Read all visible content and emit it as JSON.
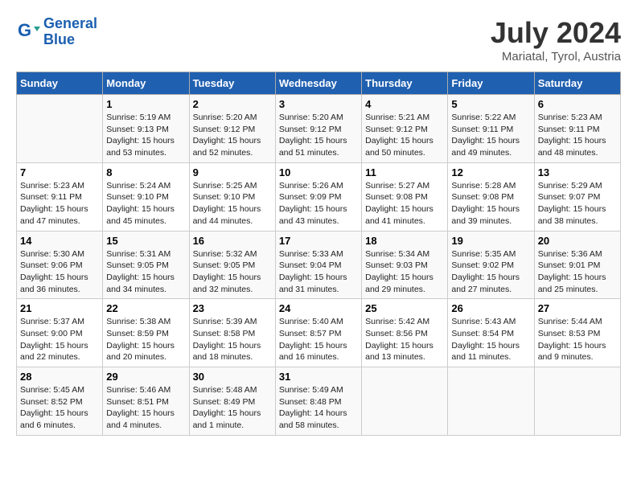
{
  "header": {
    "logo_line1": "General",
    "logo_line2": "Blue",
    "title": "July 2024",
    "location": "Mariatal, Tyrol, Austria"
  },
  "columns": [
    "Sunday",
    "Monday",
    "Tuesday",
    "Wednesday",
    "Thursday",
    "Friday",
    "Saturday"
  ],
  "weeks": [
    [
      {
        "day": "",
        "info": ""
      },
      {
        "day": "1",
        "info": "Sunrise: 5:19 AM\nSunset: 9:13 PM\nDaylight: 15 hours\nand 53 minutes."
      },
      {
        "day": "2",
        "info": "Sunrise: 5:20 AM\nSunset: 9:12 PM\nDaylight: 15 hours\nand 52 minutes."
      },
      {
        "day": "3",
        "info": "Sunrise: 5:20 AM\nSunset: 9:12 PM\nDaylight: 15 hours\nand 51 minutes."
      },
      {
        "day": "4",
        "info": "Sunrise: 5:21 AM\nSunset: 9:12 PM\nDaylight: 15 hours\nand 50 minutes."
      },
      {
        "day": "5",
        "info": "Sunrise: 5:22 AM\nSunset: 9:11 PM\nDaylight: 15 hours\nand 49 minutes."
      },
      {
        "day": "6",
        "info": "Sunrise: 5:23 AM\nSunset: 9:11 PM\nDaylight: 15 hours\nand 48 minutes."
      }
    ],
    [
      {
        "day": "7",
        "info": "Sunrise: 5:23 AM\nSunset: 9:11 PM\nDaylight: 15 hours\nand 47 minutes."
      },
      {
        "day": "8",
        "info": "Sunrise: 5:24 AM\nSunset: 9:10 PM\nDaylight: 15 hours\nand 45 minutes."
      },
      {
        "day": "9",
        "info": "Sunrise: 5:25 AM\nSunset: 9:10 PM\nDaylight: 15 hours\nand 44 minutes."
      },
      {
        "day": "10",
        "info": "Sunrise: 5:26 AM\nSunset: 9:09 PM\nDaylight: 15 hours\nand 43 minutes."
      },
      {
        "day": "11",
        "info": "Sunrise: 5:27 AM\nSunset: 9:08 PM\nDaylight: 15 hours\nand 41 minutes."
      },
      {
        "day": "12",
        "info": "Sunrise: 5:28 AM\nSunset: 9:08 PM\nDaylight: 15 hours\nand 39 minutes."
      },
      {
        "day": "13",
        "info": "Sunrise: 5:29 AM\nSunset: 9:07 PM\nDaylight: 15 hours\nand 38 minutes."
      }
    ],
    [
      {
        "day": "14",
        "info": "Sunrise: 5:30 AM\nSunset: 9:06 PM\nDaylight: 15 hours\nand 36 minutes."
      },
      {
        "day": "15",
        "info": "Sunrise: 5:31 AM\nSunset: 9:05 PM\nDaylight: 15 hours\nand 34 minutes."
      },
      {
        "day": "16",
        "info": "Sunrise: 5:32 AM\nSunset: 9:05 PM\nDaylight: 15 hours\nand 32 minutes."
      },
      {
        "day": "17",
        "info": "Sunrise: 5:33 AM\nSunset: 9:04 PM\nDaylight: 15 hours\nand 31 minutes."
      },
      {
        "day": "18",
        "info": "Sunrise: 5:34 AM\nSunset: 9:03 PM\nDaylight: 15 hours\nand 29 minutes."
      },
      {
        "day": "19",
        "info": "Sunrise: 5:35 AM\nSunset: 9:02 PM\nDaylight: 15 hours\nand 27 minutes."
      },
      {
        "day": "20",
        "info": "Sunrise: 5:36 AM\nSunset: 9:01 PM\nDaylight: 15 hours\nand 25 minutes."
      }
    ],
    [
      {
        "day": "21",
        "info": "Sunrise: 5:37 AM\nSunset: 9:00 PM\nDaylight: 15 hours\nand 22 minutes."
      },
      {
        "day": "22",
        "info": "Sunrise: 5:38 AM\nSunset: 8:59 PM\nDaylight: 15 hours\nand 20 minutes."
      },
      {
        "day": "23",
        "info": "Sunrise: 5:39 AM\nSunset: 8:58 PM\nDaylight: 15 hours\nand 18 minutes."
      },
      {
        "day": "24",
        "info": "Sunrise: 5:40 AM\nSunset: 8:57 PM\nDaylight: 15 hours\nand 16 minutes."
      },
      {
        "day": "25",
        "info": "Sunrise: 5:42 AM\nSunset: 8:56 PM\nDaylight: 15 hours\nand 13 minutes."
      },
      {
        "day": "26",
        "info": "Sunrise: 5:43 AM\nSunset: 8:54 PM\nDaylight: 15 hours\nand 11 minutes."
      },
      {
        "day": "27",
        "info": "Sunrise: 5:44 AM\nSunset: 8:53 PM\nDaylight: 15 hours\nand 9 minutes."
      }
    ],
    [
      {
        "day": "28",
        "info": "Sunrise: 5:45 AM\nSunset: 8:52 PM\nDaylight: 15 hours\nand 6 minutes."
      },
      {
        "day": "29",
        "info": "Sunrise: 5:46 AM\nSunset: 8:51 PM\nDaylight: 15 hours\nand 4 minutes."
      },
      {
        "day": "30",
        "info": "Sunrise: 5:48 AM\nSunset: 8:49 PM\nDaylight: 15 hours\nand 1 minute."
      },
      {
        "day": "31",
        "info": "Sunrise: 5:49 AM\nSunset: 8:48 PM\nDaylight: 14 hours\nand 58 minutes."
      },
      {
        "day": "",
        "info": ""
      },
      {
        "day": "",
        "info": ""
      },
      {
        "day": "",
        "info": ""
      }
    ]
  ]
}
